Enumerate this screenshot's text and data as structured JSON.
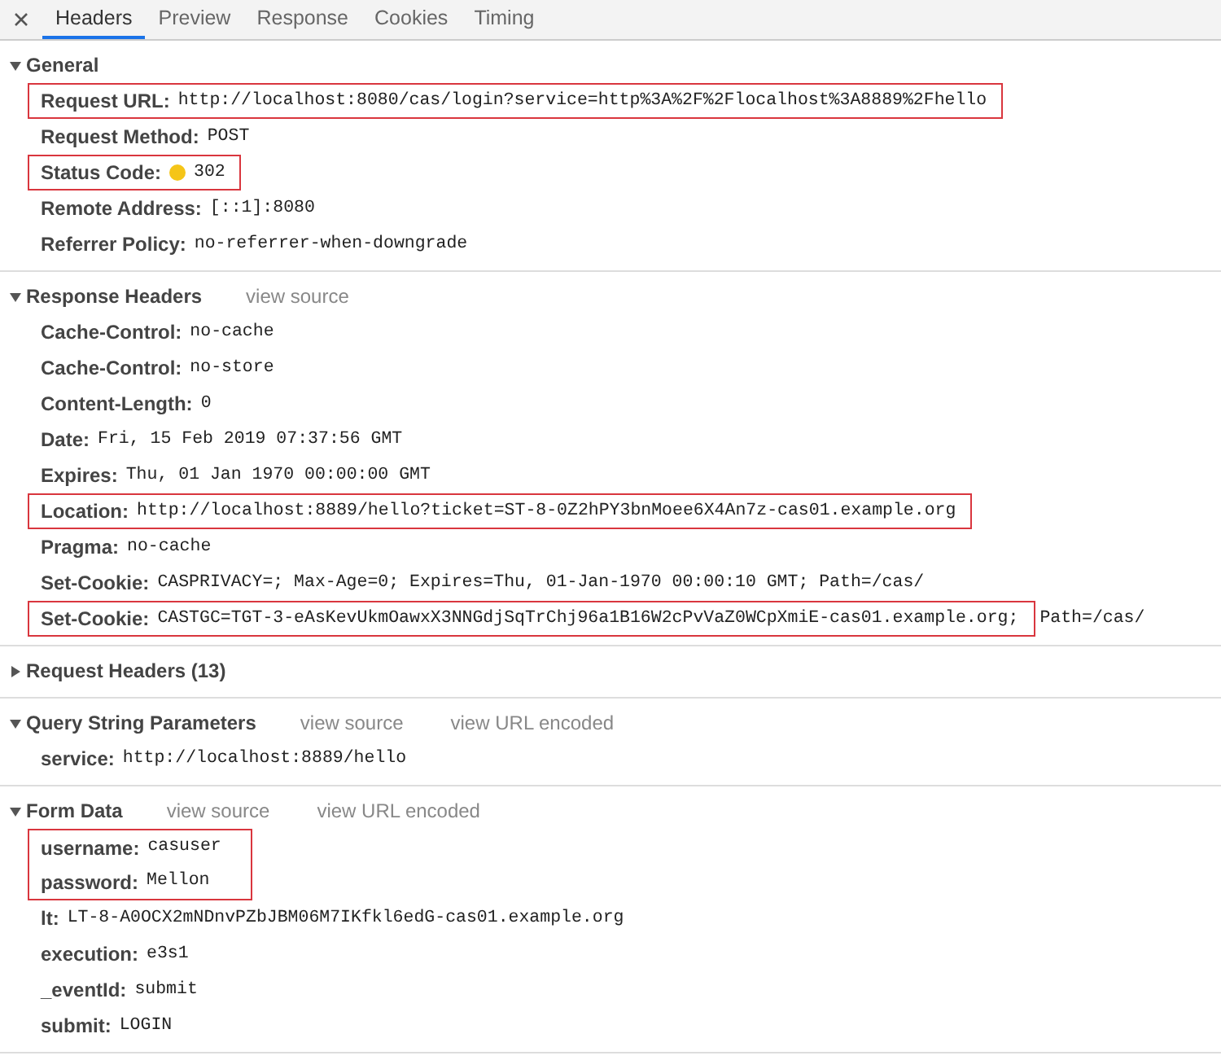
{
  "tabs": [
    {
      "label": "Headers",
      "selected": true
    },
    {
      "label": "Preview",
      "selected": false
    },
    {
      "label": "Response",
      "selected": false
    },
    {
      "label": "Cookies",
      "selected": false
    },
    {
      "label": "Timing",
      "selected": false
    }
  ],
  "sections": [
    {
      "title": "General",
      "expanded": true,
      "rows": [
        {
          "name": "Request URL:",
          "value": "http://localhost:8080/cas/login?service=http%3A%2F%2Flocalhost%3A8889%2Fhello",
          "highlighted": true
        },
        {
          "name": "Request Method:",
          "value": "POST",
          "highlighted": false
        },
        {
          "name": "Status Code:",
          "value": "302",
          "highlighted": true,
          "color": "#f5c518"
        },
        {
          "name": "Remote Address:",
          "value": "[::1]:8080",
          "highlighted": false
        },
        {
          "name": "Referrer Policy:",
          "value": "no-referrer-when-downgrade",
          "highlighted": false
        }
      ]
    },
    {
      "title": "Response Headers",
      "expanded": true,
      "links": [
        "view source"
      ],
      "rows": [
        {
          "name": "Cache-Control:",
          "value": "no-cache",
          "highlighted": false
        },
        {
          "name": "Cache-Control:",
          "value": "no-store",
          "highlighted": false
        },
        {
          "name": "Content-Length:",
          "value": "0",
          "highlighted": false
        },
        {
          "name": "Date:",
          "value": "Fri, 15 Feb 2019 07:37:56 GMT",
          "highlighted": false
        },
        {
          "name": "Expires:",
          "value": "Thu, 01 Jan 1970 00:00:00 GMT",
          "highlighted": false
        },
        {
          "name": "Location:",
          "value": "http://localhost:8889/hello?ticket=ST-8-0Z2hPY3bnMoee6X4An7z-cas01.example.org",
          "highlighted": true
        },
        {
          "name": "Pragma:",
          "value": "no-cache",
          "highlighted": false
        },
        {
          "name": "Set-Cookie:",
          "value": "CASPRIVACY=; Max-Age=0; Expires=Thu, 01-Jan-1970 00:00:10 GMT; Path=/cas/",
          "highlighted": false
        },
        {
          "name": "Set-Cookie:",
          "value": "CASTGC=TGT-3-eAsKevUkmOawxX3NNGdjSqTrChj96a1B16W2cPvVaZ0WCpXmiE-cas01.example.org;",
          "highlighted": true,
          "value_outside_highlight": "Path=/cas/"
        }
      ]
    },
    {
      "title": "Request Headers (13)",
      "expanded": false
    },
    {
      "title": "Query String Parameters",
      "expanded": true,
      "links": [
        "view source",
        "view URL encoded"
      ],
      "rows": [
        {
          "name": "service:",
          "value": "http://localhost:8889/hello",
          "highlighted": false
        }
      ]
    },
    {
      "title": "Form Data",
      "expanded": true,
      "links": [
        "view source",
        "view URL encoded"
      ],
      "rows": [
        {
          "name": "username:",
          "value": "casuser",
          "highlighted": true
        },
        {
          "name": "password:",
          "value": "Mellon",
          "highlighted": true
        },
        {
          "name": "lt:",
          "value": "LT-8-A0OCX2mNDnvPZbJBM06M7IKfkl6edG-cas01.example.org",
          "highlighted": false
        },
        {
          "name": "execution:",
          "value": "e3s1",
          "highlighted": false
        },
        {
          "name": "_eventId:",
          "value": "submit",
          "highlighted": false
        },
        {
          "name": "submit:",
          "value": "LOGIN",
          "highlighted": false
        }
      ]
    }
  ]
}
